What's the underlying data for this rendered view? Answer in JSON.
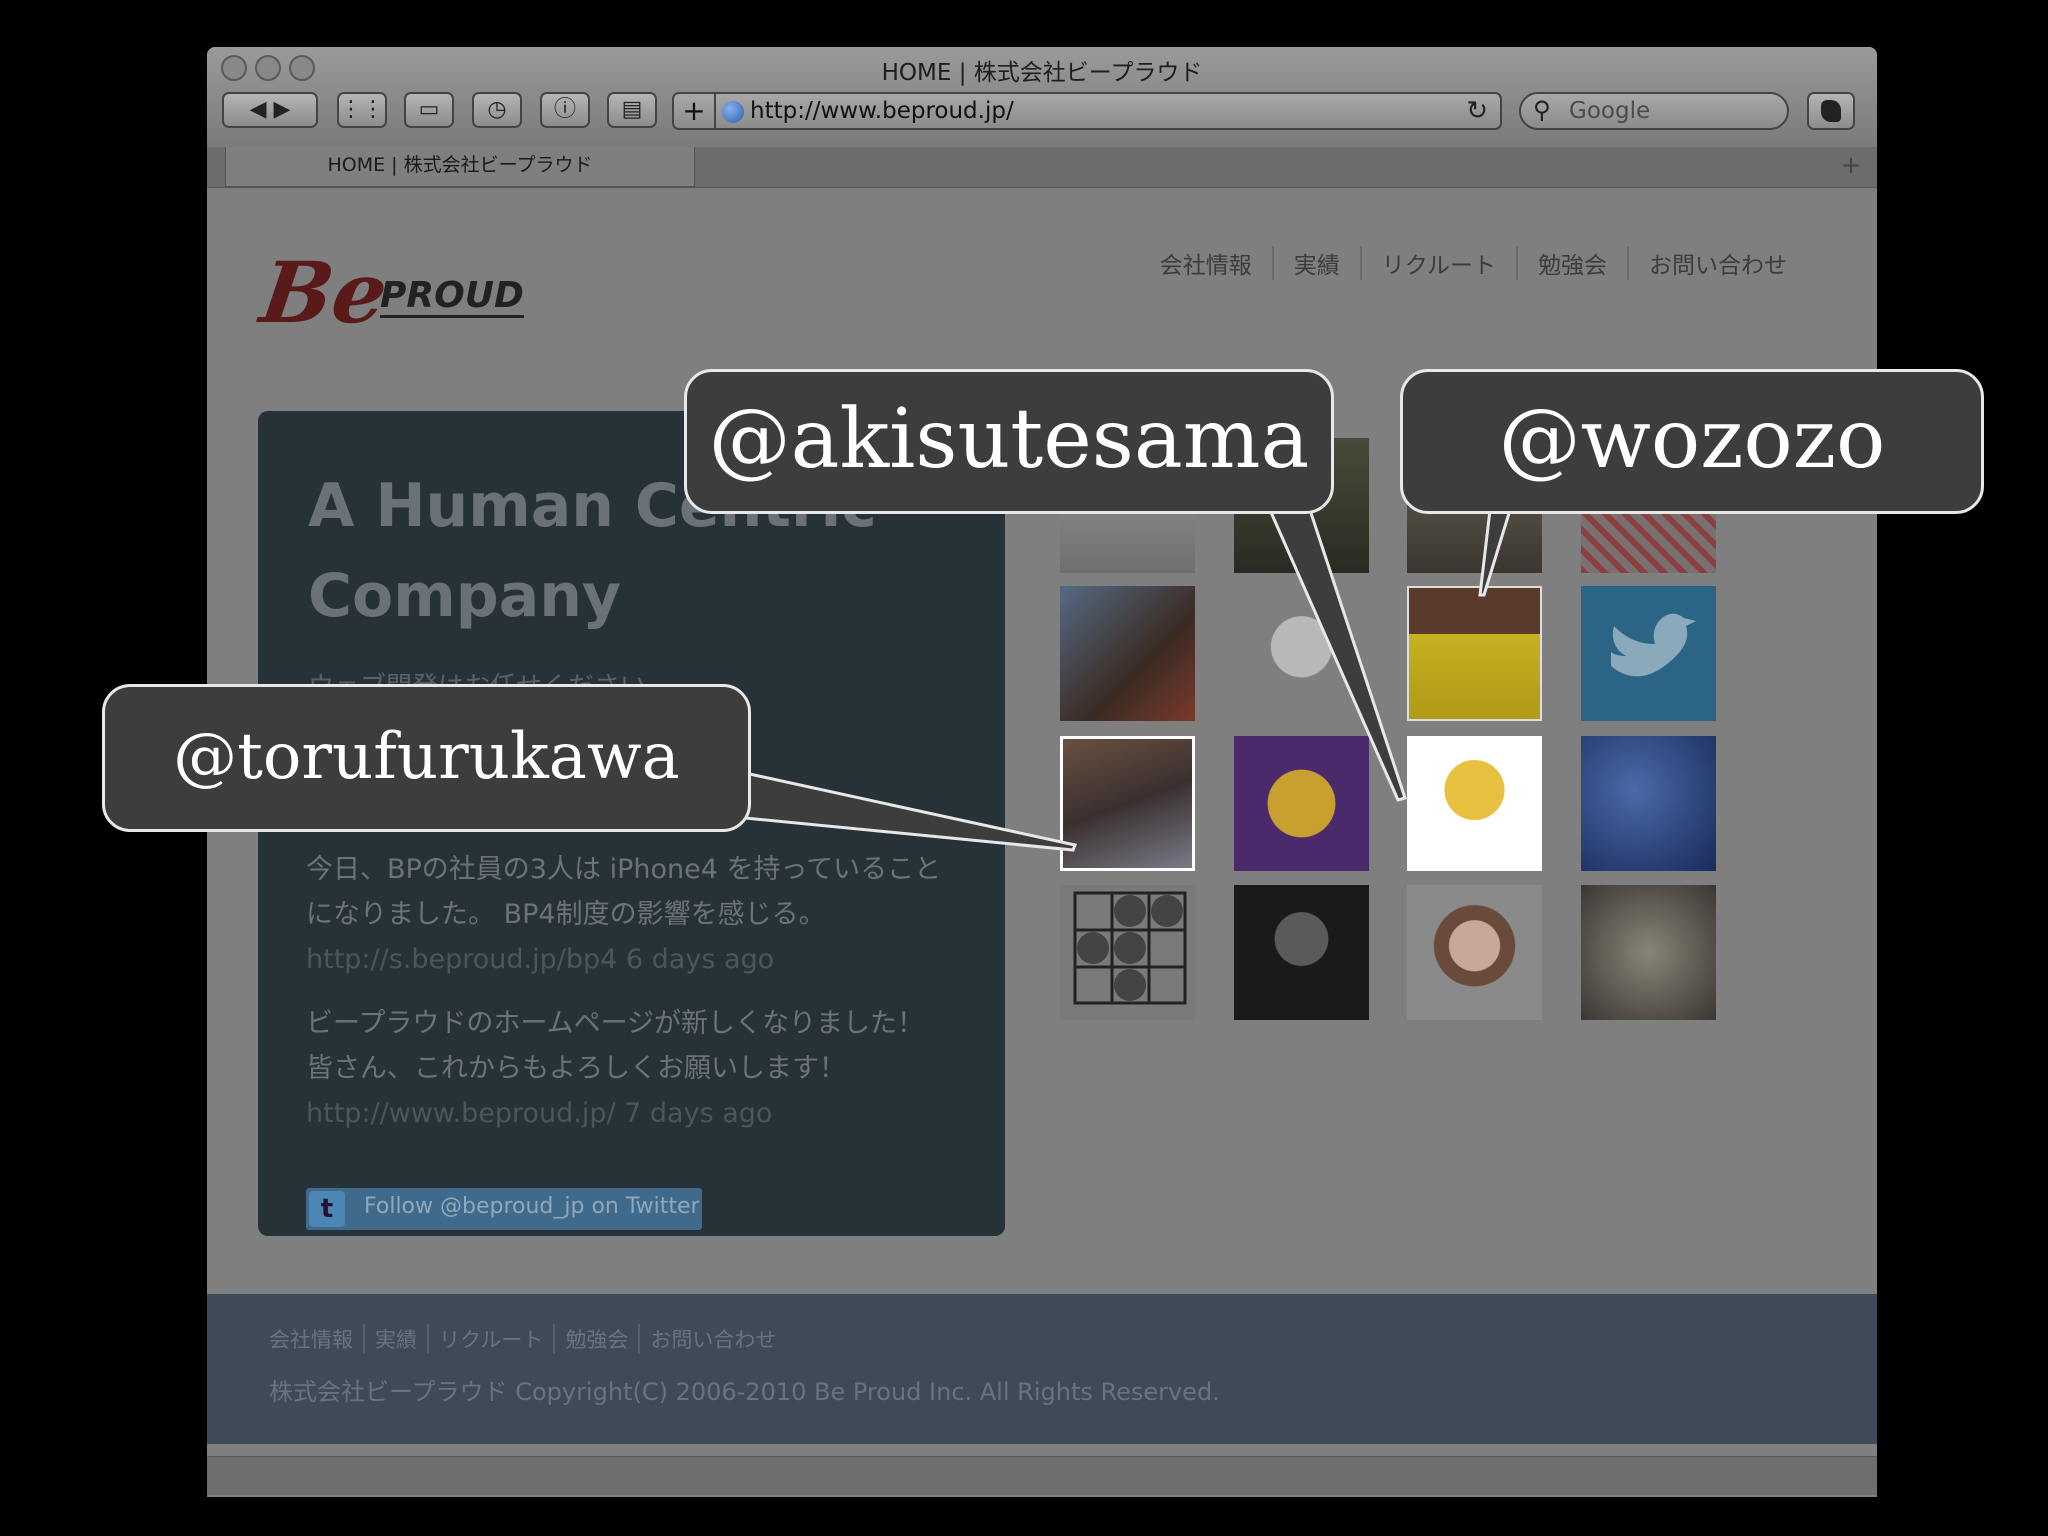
{
  "browser": {
    "window_title": "HOME | 株式会社ビープラウド",
    "tab_label": "HOME | 株式会社ビープラウド",
    "url": "http://www.beproud.jp/",
    "search_placeholder": "Google",
    "new_tab": "+"
  },
  "site": {
    "logo_be": "Be",
    "logo_proud": "PROUD",
    "nav": [
      "会社情報",
      "実績",
      "リクルート",
      "勉強会",
      "お問い合わせ"
    ]
  },
  "panel": {
    "headline": "A Human Centric Company",
    "subtitle": "ウェブ開発はお任せください",
    "tweets": [
      {
        "text": "今日、BPの社員の3人は iPhone4 を持っていることになりました。 BP4制度の影響を感じる。",
        "link": "http://s.beproud.jp/bp4",
        "time": "6 days ago"
      },
      {
        "text": "ビープラウドのホームページが新しくなりました！ 皆さん、これからもよろしくお願いします！",
        "link": "http://www.beproud.jp/",
        "time": "7 days ago"
      }
    ],
    "follow_button": "Follow @beproud_jp on Twitter"
  },
  "footer": {
    "nav": [
      "会社情報",
      "実績",
      "リクルート",
      "勉強会",
      "お問い合わせ"
    ],
    "copyright": "株式会社ビープラウド Copyright(C) 2006-2010 Be Proud Inc. All Rights Reserved."
  },
  "callouts": {
    "akisutesama": "@akisutesama",
    "wozozo": "@wozozo",
    "torufurukawa": "@torufurukawa"
  },
  "colors": {
    "page_bg": "#000000",
    "bubble_fill": "#3d3d3d",
    "bubble_border": "#e8e8e8",
    "panel": "#263238",
    "footer": "#3e4a57"
  }
}
